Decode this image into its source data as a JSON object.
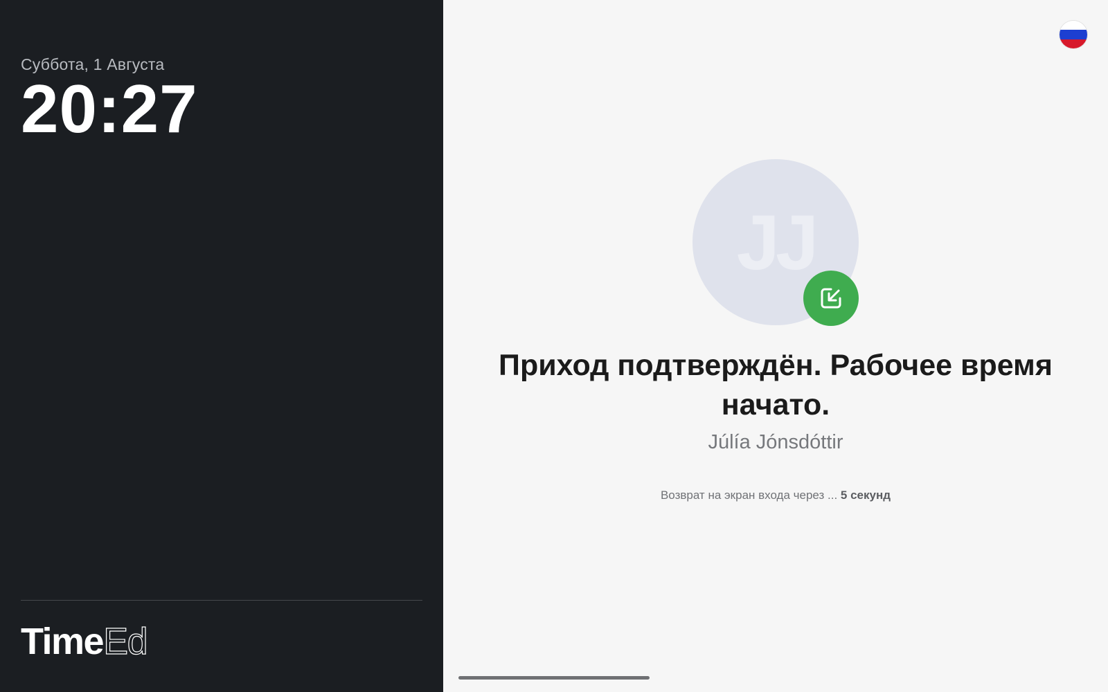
{
  "left_panel": {
    "date": "Суббота, 1 Августа",
    "time": "20:27",
    "logo": {
      "part1": "Time",
      "part2": "Ed"
    }
  },
  "header": {
    "language_flag": {
      "icon": "russia-flag-icon",
      "colors": [
        "#ffffff",
        "#1c3fd1",
        "#d7192b"
      ]
    }
  },
  "user": {
    "initials": "JJ",
    "name": "Júlía Jónsdóttir",
    "badge_icon": "check-in-arrow-icon"
  },
  "status": {
    "title": "Приход подтверждён. Рабочее время начато.",
    "countdown_prefix": "Возврат на экран входа через ... ",
    "countdown_value": "5 секунд"
  },
  "colors": {
    "left_background": "#1b1e22",
    "right_background": "#f6f6f6",
    "badge_green": "#3fac4f",
    "avatar_bg": "#dfe2ec"
  }
}
